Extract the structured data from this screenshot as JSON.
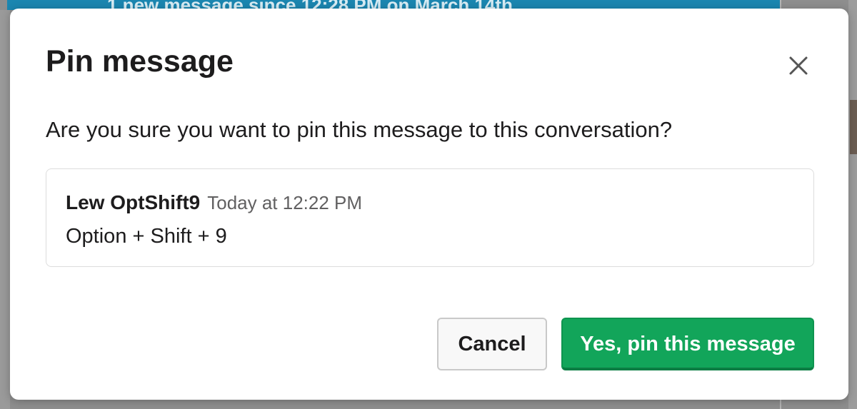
{
  "background": {
    "banner_text": "1 new message since 12:28 PM on March 14th"
  },
  "dialog": {
    "title": "Pin message",
    "prompt": "Are you sure you want to pin this message to this conversation?",
    "message_preview": {
      "author": "Lew OptShift9",
      "timestamp": "Today at 12:22 PM",
      "text": "Option + Shift + 9"
    },
    "buttons": {
      "cancel_label": "Cancel",
      "confirm_label": "Yes, pin this message"
    }
  },
  "colors": {
    "confirm_button": "#12a55a",
    "banner": "#1b86b0",
    "overlay": "#8e8e8e"
  },
  "icons": {
    "close": "close-icon"
  }
}
